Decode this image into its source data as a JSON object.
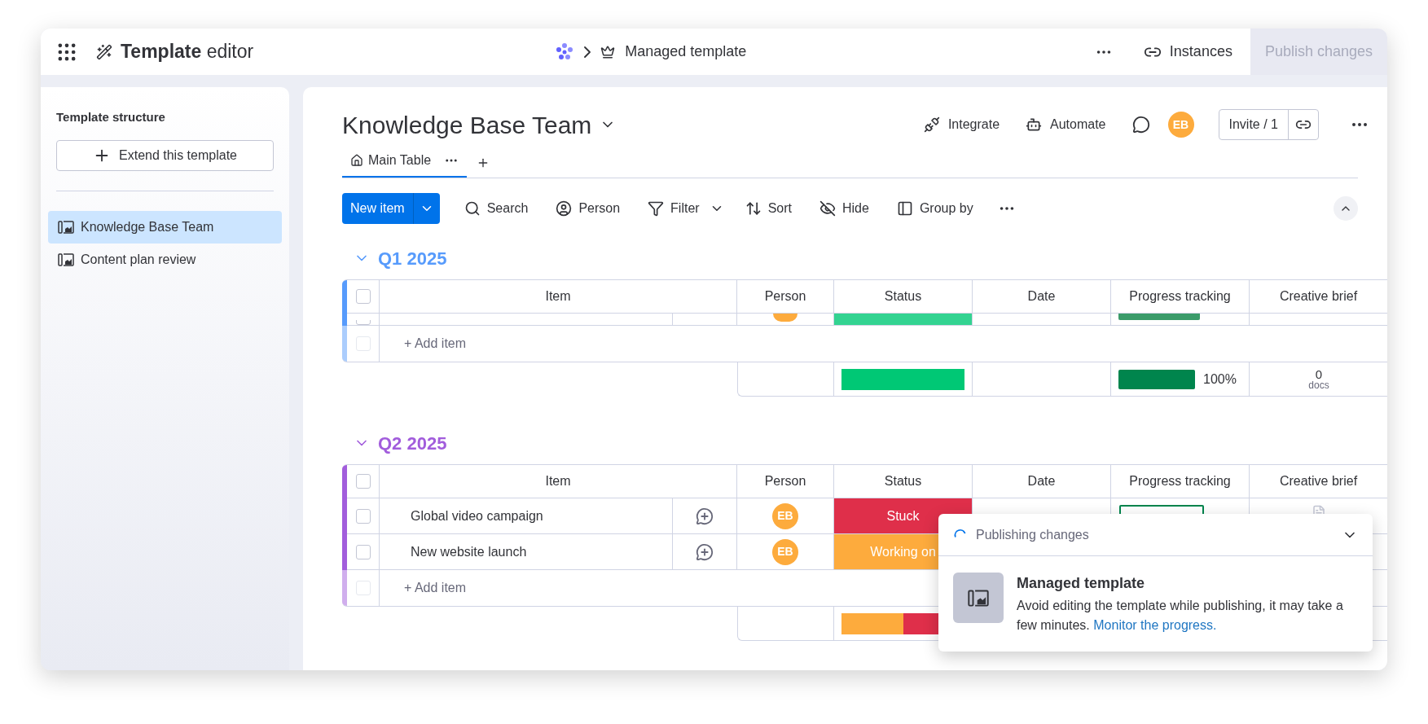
{
  "top_bar": {
    "title": "**Template** editor",
    "breadcrumb": "Managed template",
    "instances": "Instances",
    "publish": {
      "label": "Publish changes",
      "disabled": true
    }
  },
  "sidebar": {
    "heading": "Template structure",
    "extend_button": "Extend this template",
    "items": [
      {
        "label": "Knowledge Base Team",
        "selected": true
      },
      {
        "label": "Content plan review",
        "selected": false
      }
    ]
  },
  "board": {
    "title": "Knowledge Base Team",
    "actions": [
      {
        "kind": "integrate",
        "label": "Integrate"
      },
      {
        "kind": "automate",
        "label": "Automate"
      }
    ],
    "avatar": "EB",
    "invite": "Invite / 1",
    "tabs": [
      {
        "label": "Main Table",
        "selected": true
      }
    ],
    "toolbar": {
      "new_item": "New item",
      "tools": [
        {
          "kind": "search",
          "label": "Search"
        },
        {
          "kind": "person",
          "label": "Person"
        },
        {
          "kind": "filter",
          "label": "Filter"
        },
        {
          "kind": "sort",
          "label": "Sort"
        },
        {
          "kind": "hide",
          "label": "Hide"
        },
        {
          "kind": "group",
          "label": "Group by"
        }
      ]
    }
  },
  "groups": [
    {
      "title": "Q1 2025",
      "color": "#579bfc",
      "select_all": {
        "checked": false
      },
      "columns": [
        "Item",
        "Person",
        "Status",
        "Date",
        "Progress tracking",
        "Creative brief"
      ],
      "clipped_row": {
        "color": "#33d391",
        "checked": false,
        "progress": {
          "level": 1
        }
      },
      "add_row": {
        "label": "+ Add item",
        "checked": false
      },
      "summary": {
        "status": [
          {
            "color": "#00c875",
            "level": 1
          }
        ],
        "progress": {
          "level": 1,
          "reading": "100%"
        },
        "docs": {
          "count": "0",
          "unit": "docs"
        }
      }
    },
    {
      "title": "Q2 2025",
      "color": "#a25ddc",
      "select_all": {
        "checked": false
      },
      "columns": [
        "Item",
        "Person",
        "Status",
        "Date",
        "Progress tracking",
        "Creative brief"
      ],
      "rows": [
        {
          "item": "Global video campaign",
          "checked": false,
          "person": "EB",
          "status": {
            "label": "Stuck",
            "color": "#df2f4a"
          },
          "progress": {
            "level": 0
          }
        },
        {
          "item": "New website launch",
          "checked": false,
          "person": "EB",
          "status": {
            "label": "Working on",
            "color": "#fdab3d"
          }
        }
      ],
      "add_row": {
        "label": "+ Add item",
        "checked": false
      },
      "summary": {
        "status": [
          {
            "color": "#fdab3d",
            "level": 0.5
          },
          {
            "color": "#df2f4a",
            "level": 0.5
          }
        ]
      }
    }
  ],
  "toast": {
    "title": "Publishing changes",
    "heading": "Managed template",
    "message": "Avoid editing the template while publishing, it may take a few minutes.",
    "link": "Monitor the progress."
  }
}
